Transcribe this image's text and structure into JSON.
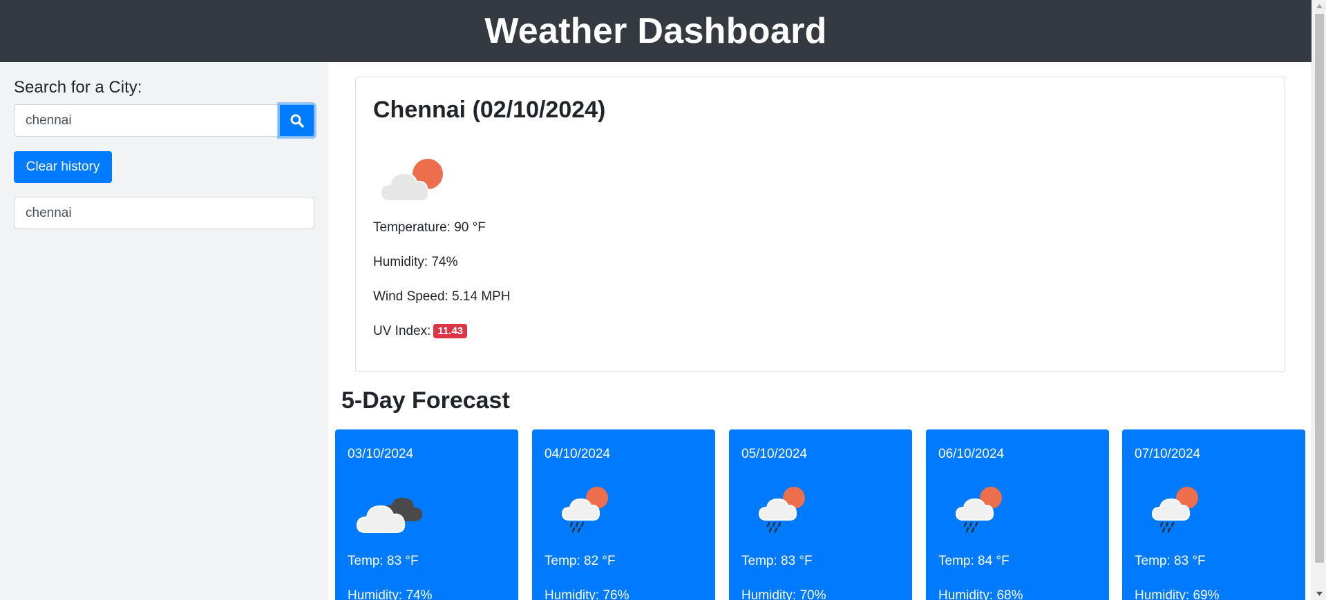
{
  "header": {
    "title": "Weather Dashboard"
  },
  "sidebar": {
    "search_label": "Search for a City:",
    "search_value": "chennai",
    "search_icon": "search-icon",
    "clear_label": "Clear history",
    "history": [
      "chennai"
    ]
  },
  "current": {
    "title": "Chennai (02/10/2024)",
    "icon": "partly-cloudy-icon",
    "temperature": "Temperature: 90 °F",
    "humidity": "Humidity: 74%",
    "wind": "Wind Speed: 5.14 MPH",
    "uv_label": "UV Index:",
    "uv_value": "11.43"
  },
  "forecast": {
    "title": "5-Day Forecast",
    "days": [
      {
        "date": "03/10/2024",
        "icon": "broken-clouds-icon",
        "temp": "Temp: 83 °F",
        "humidity": "Humidity: 74%"
      },
      {
        "date": "04/10/2024",
        "icon": "rain-icon",
        "temp": "Temp: 82 °F",
        "humidity": "Humidity: 76%"
      },
      {
        "date": "05/10/2024",
        "icon": "rain-icon",
        "temp": "Temp: 83 °F",
        "humidity": "Humidity: 70%"
      },
      {
        "date": "06/10/2024",
        "icon": "rain-icon",
        "temp": "Temp: 84 °F",
        "humidity": "Humidity: 68%"
      },
      {
        "date": "07/10/2024",
        "icon": "rain-icon",
        "temp": "Temp: 83 °F",
        "humidity": "Humidity: 69%"
      }
    ]
  },
  "colors": {
    "header_bg": "#343a40",
    "accent": "#007bff",
    "uv_badge": "#dc3545",
    "sidebar_bg": "#f1f3f5"
  }
}
